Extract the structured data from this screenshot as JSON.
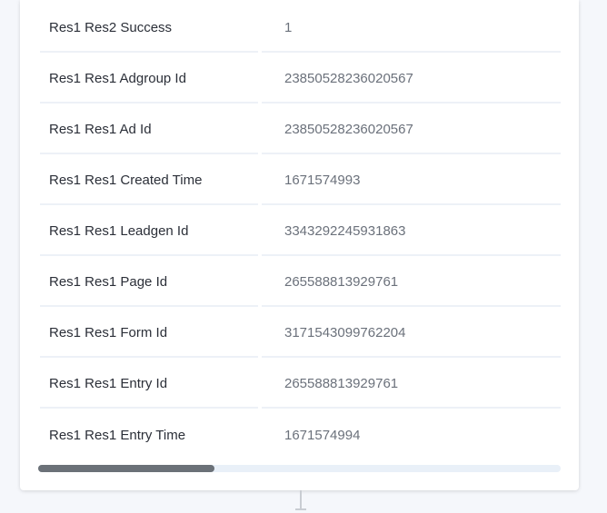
{
  "rows": [
    {
      "key": "Res1 Res2 Success",
      "value": "1"
    },
    {
      "key": "Res1 Res1 Adgroup Id",
      "value": "23850528236020567"
    },
    {
      "key": "Res1 Res1 Ad Id",
      "value": "23850528236020567"
    },
    {
      "key": "Res1 Res1 Created Time",
      "value": "1671574993"
    },
    {
      "key": "Res1 Res1 Leadgen Id",
      "value": "3343292245931863"
    },
    {
      "key": "Res1 Res1 Page Id",
      "value": "265588813929761"
    },
    {
      "key": "Res1 Res1 Form Id",
      "value": "3171543099762204"
    },
    {
      "key": "Res1 Res1 Entry Id",
      "value": "265588813929761"
    },
    {
      "key": "Res1 Res1 Entry Time",
      "value": "1671574994"
    }
  ],
  "scrollbar": {
    "position_fraction": 0.0,
    "visible_fraction": 0.34
  },
  "colors": {
    "key_text": "#2b2f38",
    "value_text": "#6b717b",
    "row_divider": "#edf1f7",
    "scroll_thumb": "#6b7178",
    "scroll_track": "#e9f0f8"
  }
}
